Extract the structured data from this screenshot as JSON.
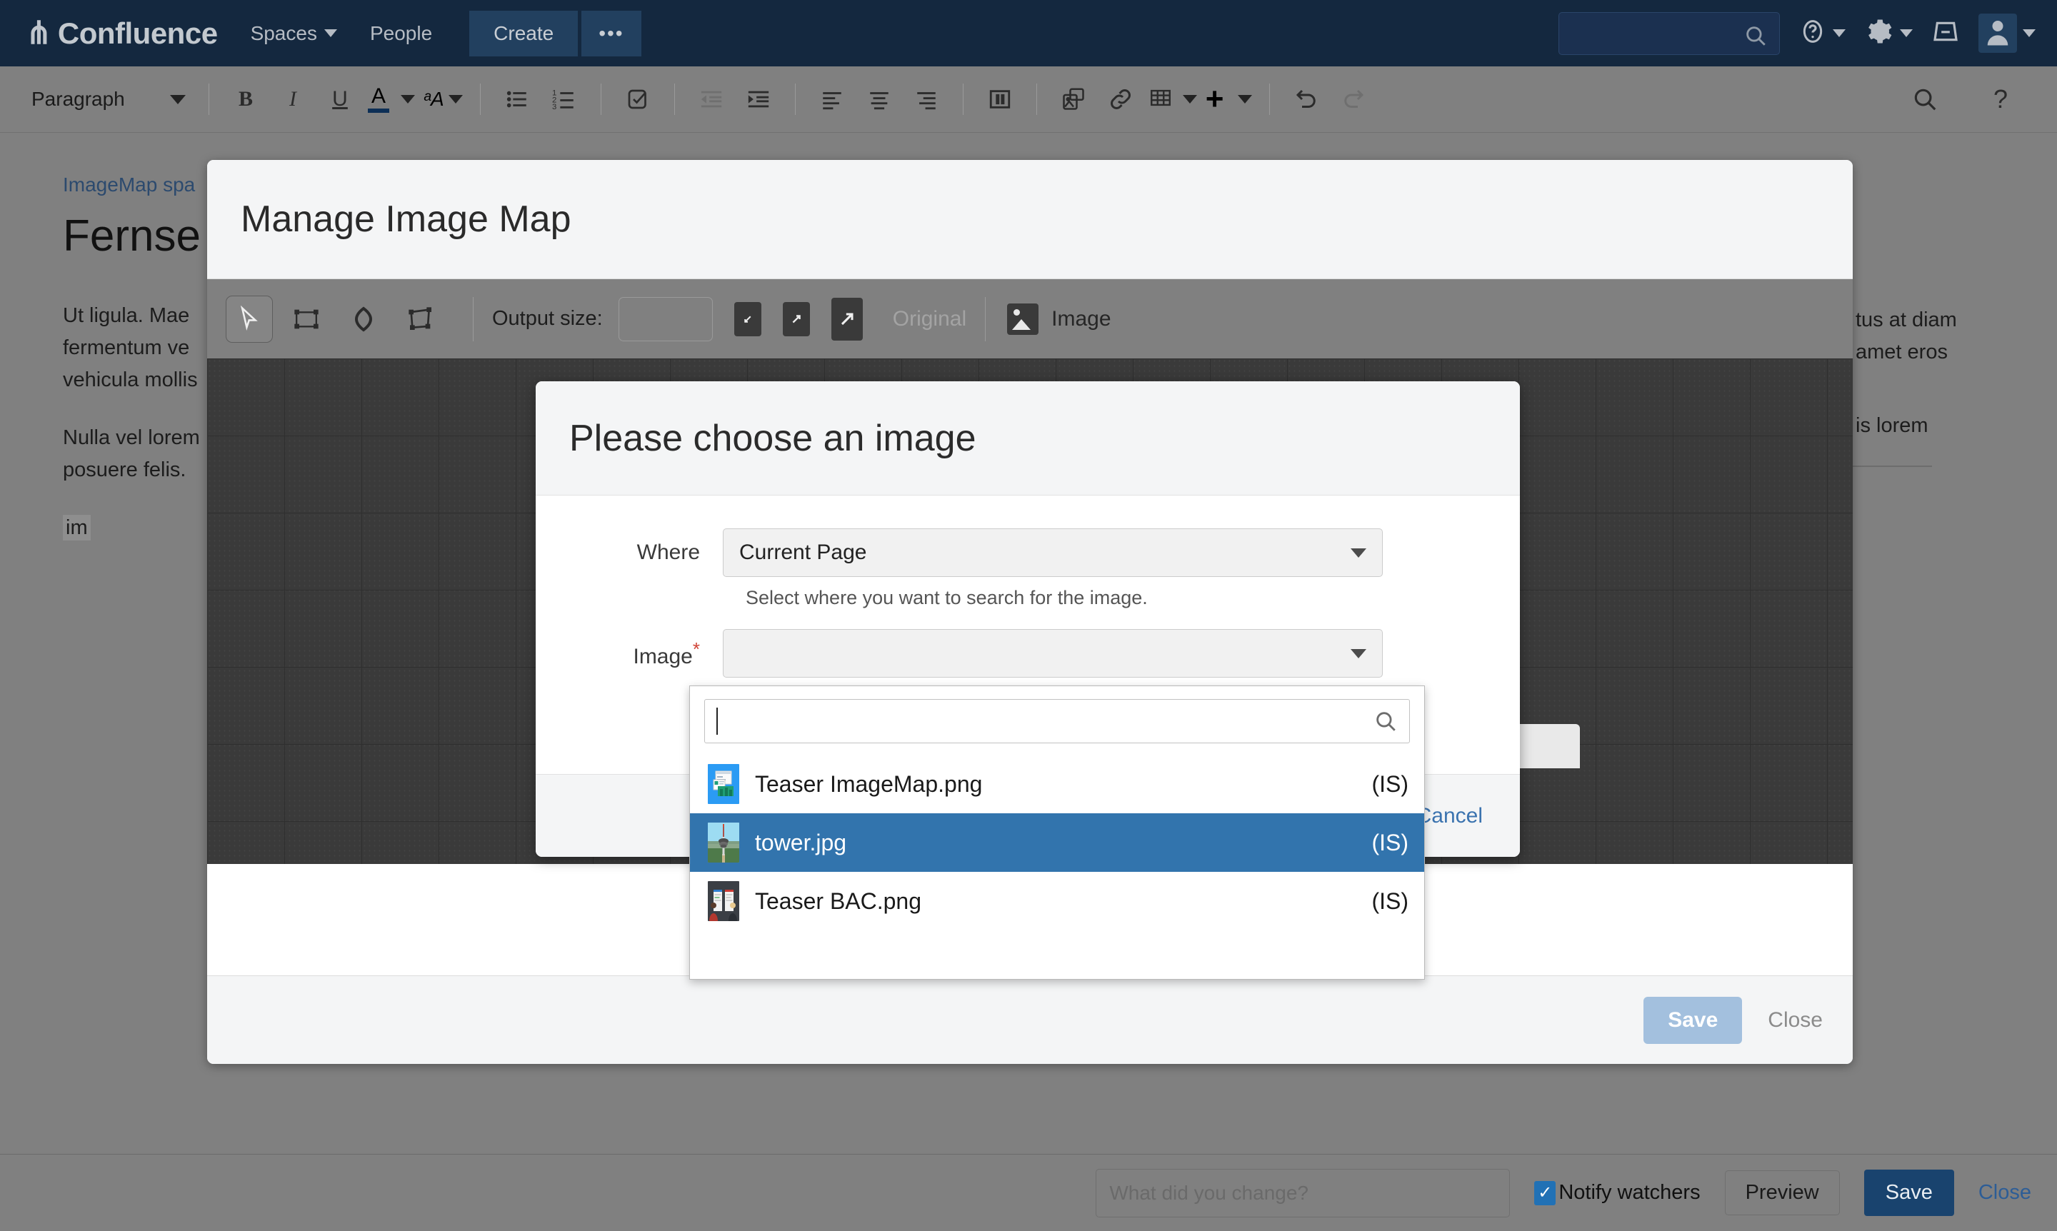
{
  "topnav": {
    "logo_text": "Confluence",
    "logo_icon": "confluence-logo-icon",
    "spaces_label": "Spaces",
    "people_label": "People",
    "create_label": "Create",
    "more_label": "•••",
    "search_placeholder": "",
    "icons": {
      "search": "search-icon",
      "help": "help-icon",
      "settings": "gear-icon",
      "inbox": "inbox-icon",
      "avatar": "avatar-icon"
    },
    "colors": {
      "bg": "#14283f",
      "button": "#22405f",
      "text": "#b6bcc4"
    }
  },
  "editor_toolbar": {
    "paragraph_label": "Paragraph",
    "bold_label": "B",
    "italic_label": "I",
    "underline_label": "U",
    "text_color_label": "A",
    "highlight_label": "ᵃA",
    "search_icon": "search-icon",
    "help_icon": "help-icon"
  },
  "page": {
    "breadcrumb": "ImageMap spa",
    "title": "Fernse",
    "paragraph_1_left": "Ut ligula. Mae",
    "paragraph_1_left_2": "fermentum ve",
    "paragraph_1_left_3": "vehicula mollis",
    "paragraph_2_left": "Nulla vel lorem",
    "paragraph_2_left_2": "posuere felis.",
    "im_chip": "im",
    "right_1": "tus at diam",
    "right_2": "amet eros",
    "right_3": "is lorem"
  },
  "bottombar": {
    "change_placeholder": "What did you change?",
    "change_value": "",
    "notify_label": "Notify watchers",
    "notify_checked": true,
    "check_glyph": "✓",
    "preview_label": "Preview",
    "save_label": "Save",
    "close_label": "Close",
    "save_color": "#19436e"
  },
  "manage_dialog": {
    "title": "Manage Image Map",
    "tools": [
      {
        "name": "select-tool",
        "glyph": "▶",
        "active": true
      },
      {
        "name": "rectangle-tool",
        "glyph": "▭",
        "active": false
      },
      {
        "name": "circle-tool",
        "glyph": "○",
        "active": false
      },
      {
        "name": "polygon-tool",
        "glyph": "▱",
        "active": false
      }
    ],
    "output_size_label": "Output size:",
    "output_size_value": "",
    "size_small_icon": "resize-small-icon",
    "size_medium_icon": "resize-medium-icon",
    "size_large_icon": "resize-large-icon",
    "original_label": "Original",
    "image_button_label": "Image",
    "image_button_icon": "image-icon",
    "save_label": "Save",
    "save_disabled": true,
    "close_label": "Close"
  },
  "choose_image_modal": {
    "title": "Please choose an image",
    "where_label": "Where",
    "where_value": "Current Page",
    "where_help": "Select where you want to search for the image.",
    "image_label": "Image",
    "image_required_marker": "*",
    "image_value": "",
    "cancel_label": "Cancel",
    "dropdown": {
      "search_value": "",
      "search_icon": "search-icon",
      "items": [
        {
          "name": "Teaser ImageMap.png",
          "tag": "(IS)",
          "selected": false,
          "thumb": "teaser-imagemap-thumb"
        },
        {
          "name": "tower.jpg",
          "tag": "(IS)",
          "selected": true,
          "thumb": "tower-thumb"
        },
        {
          "name": "Teaser BAC.png",
          "tag": "(IS)",
          "selected": false,
          "thumb": "teaser-bac-thumb"
        }
      ],
      "selected_color": "#3274ad"
    }
  }
}
